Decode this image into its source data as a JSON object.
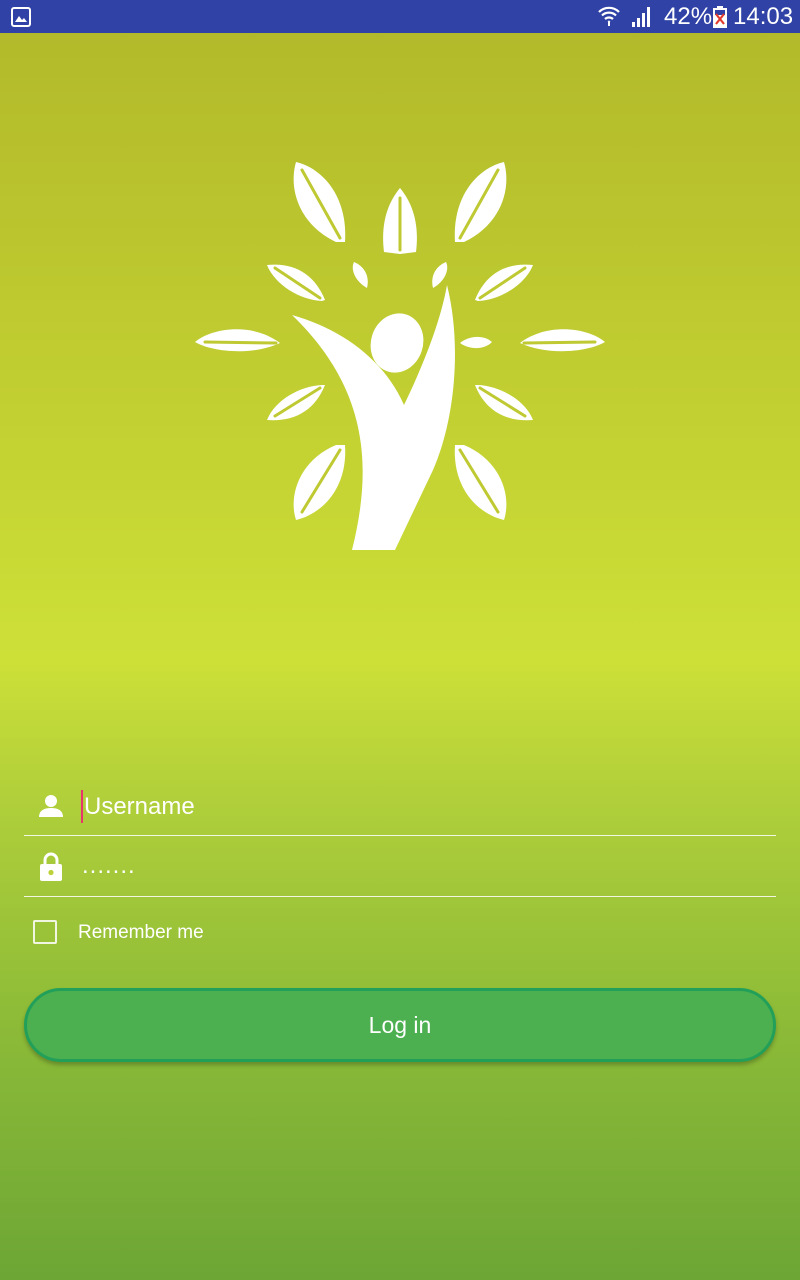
{
  "status_bar": {
    "notification_icon": "gallery-icon",
    "wifi_icon": "wifi-icon",
    "signal_icon": "signal-icon",
    "battery_percent": "42%",
    "battery_icon": "battery-icon",
    "time": "14:03",
    "background_color": "#3042a5"
  },
  "logo": {
    "icon": "tree-person-icon",
    "color": "#ffffff"
  },
  "form": {
    "username": {
      "icon": "person-icon",
      "placeholder": "Username",
      "value": ""
    },
    "password": {
      "icon": "lock-icon",
      "masked_value": "......."
    },
    "remember_me": {
      "label": "Remember me",
      "checked": false
    },
    "login_button": {
      "label": "Log in",
      "color": "#4cb050",
      "border_color": "#22a05a"
    }
  },
  "background": {
    "gradient_colors": [
      "#b1b82a",
      "#cde038",
      "#6da635"
    ]
  }
}
